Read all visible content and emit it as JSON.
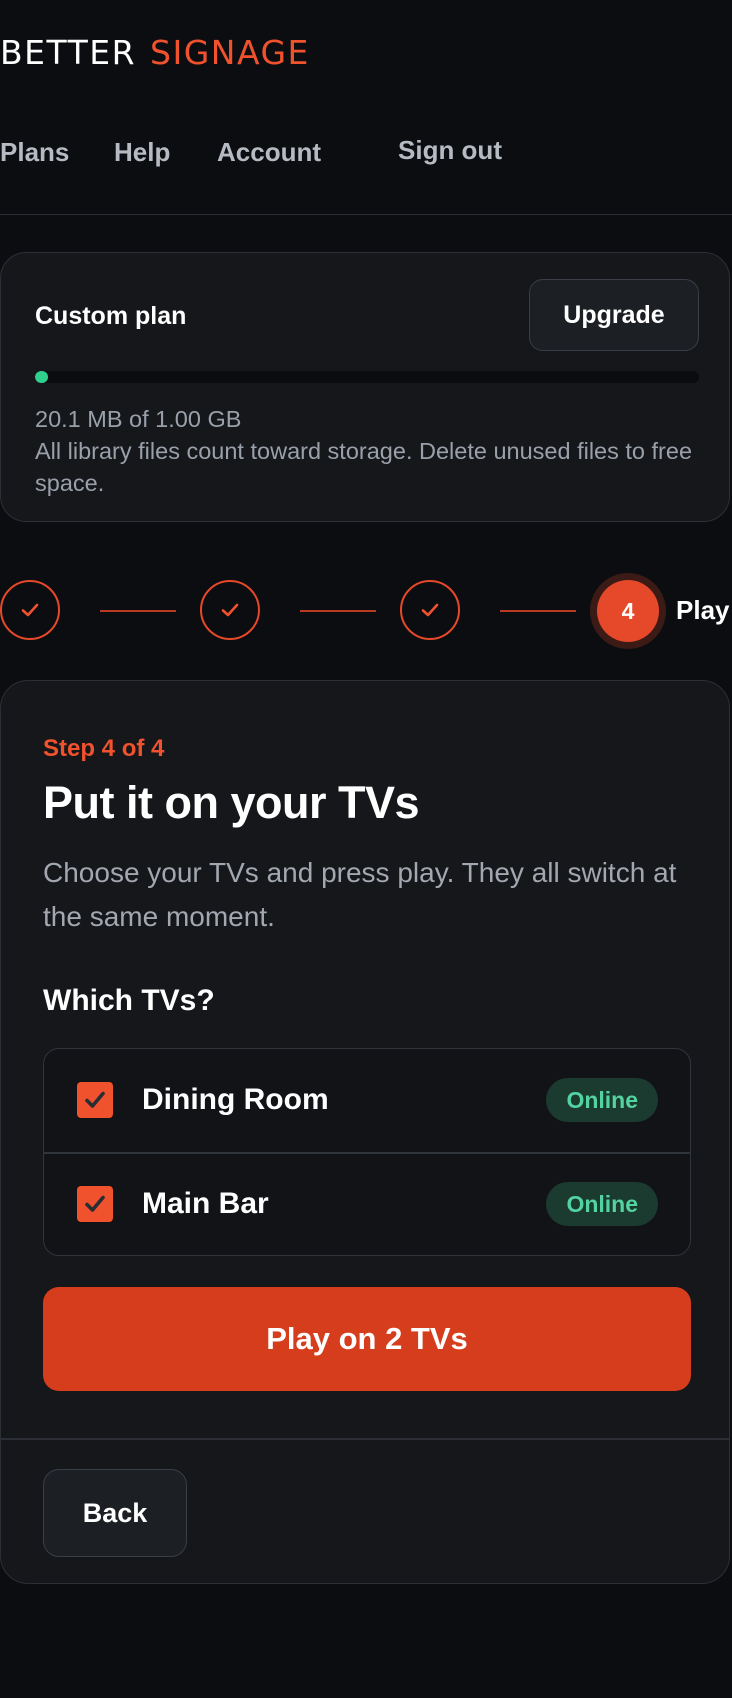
{
  "brand": {
    "word1": "BETTER",
    "word2": "SIGNAGE",
    "accent_color": "#f0522d"
  },
  "nav": {
    "items": [
      {
        "label": "Plans"
      },
      {
        "label": "Help"
      },
      {
        "label": "Account"
      },
      {
        "label": "Sign out"
      }
    ]
  },
  "storage": {
    "plan_name": "Custom plan",
    "upgrade_label": "Upgrade",
    "used_fraction": 0.02,
    "bar_color": "#2fcf8e",
    "used_text": "20.1 MB of 1.00 GB",
    "note": "All library files count toward storage. Delete unused files to free space."
  },
  "stepper": {
    "steps": [
      {
        "state": "completed",
        "icon": "check-icon"
      },
      {
        "state": "completed",
        "icon": "check-icon"
      },
      {
        "state": "completed",
        "icon": "check-icon"
      },
      {
        "state": "active",
        "number": "4",
        "label": "Play"
      }
    ]
  },
  "main": {
    "kicker": "Step 4 of 4",
    "title": "Put it on your TVs",
    "description": "Choose your TVs and press play. They all switch at the same moment.",
    "tv_heading": "Which TVs?",
    "tvs": [
      {
        "name": "Dining Room",
        "status": "Online",
        "checked": true
      },
      {
        "name": "Main Bar",
        "status": "Online",
        "checked": true
      }
    ],
    "play_label": "Play on 2 TVs",
    "back_label": "Back"
  }
}
